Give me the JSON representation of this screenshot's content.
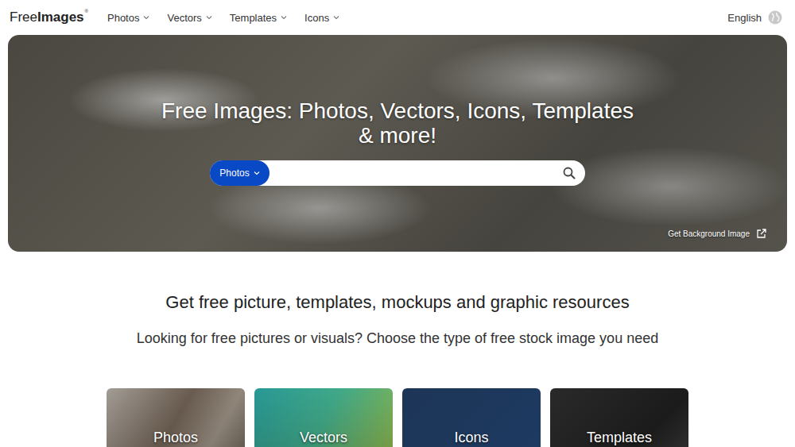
{
  "logo": {
    "parts": [
      "Free",
      "Images"
    ],
    "mark": "®"
  },
  "nav": [
    {
      "label": "Photos"
    },
    {
      "label": "Vectors"
    },
    {
      "label": "Templates"
    },
    {
      "label": "Icons"
    }
  ],
  "language": {
    "label": "English"
  },
  "hero": {
    "title": "Free Images: Photos, Vectors, Icons, Templates & more!",
    "search": {
      "category": "Photos"
    },
    "background_link": "Get Background Image"
  },
  "intro": {
    "heading": "Get free picture, templates, mockups and graphic resources",
    "subheading": "Looking for free pictures or visuals? Choose the type of free stock image you need"
  },
  "categories": [
    {
      "label": "Photos"
    },
    {
      "label": "Vectors"
    },
    {
      "label": "Icons"
    },
    {
      "label": "Templates"
    }
  ]
}
